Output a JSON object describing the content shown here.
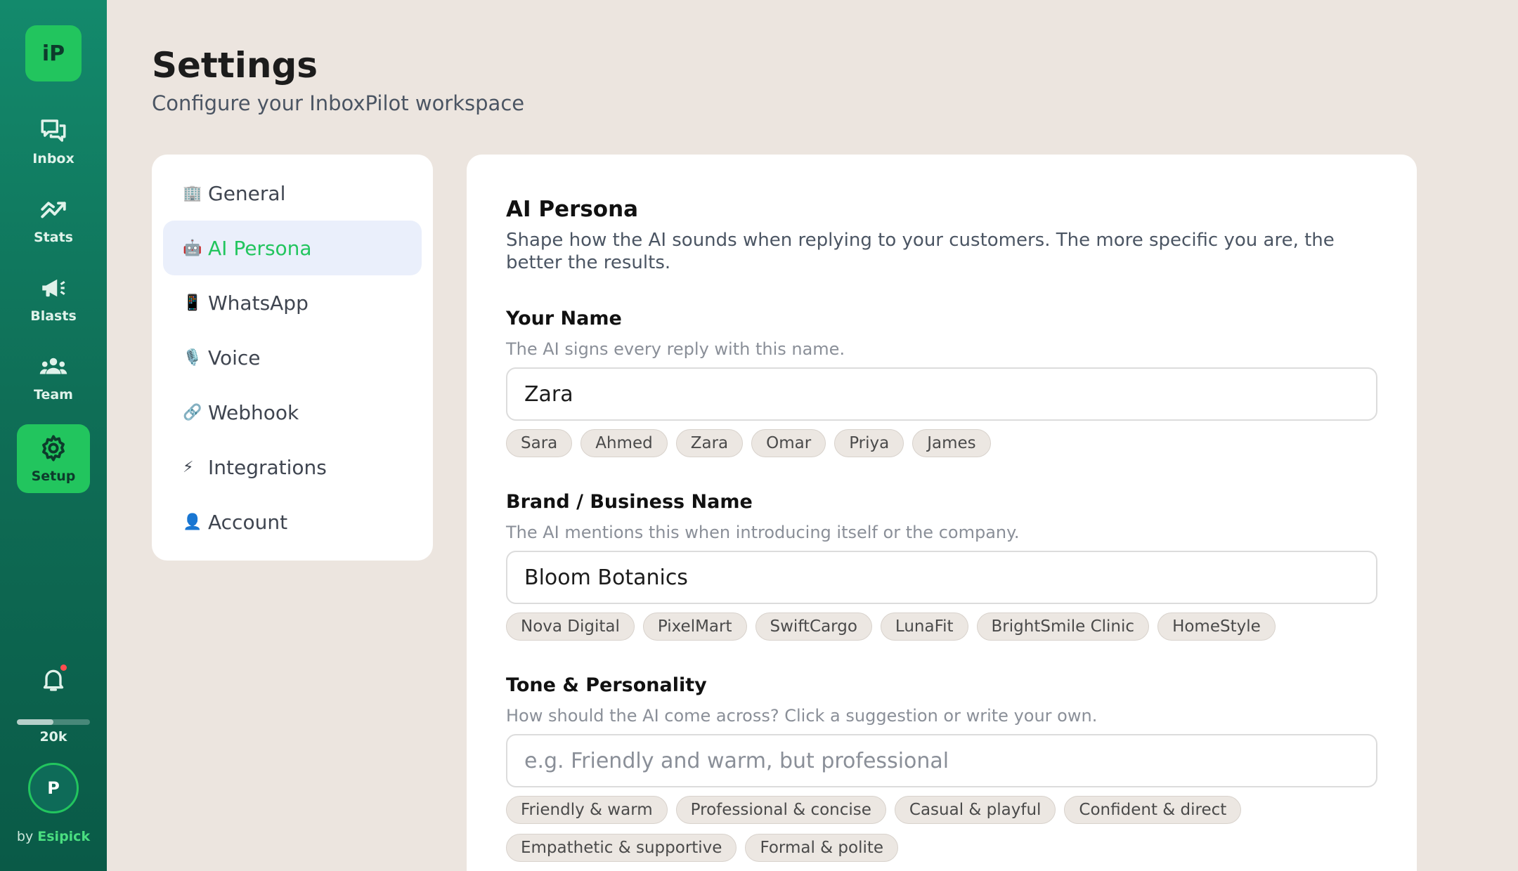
{
  "brand": {
    "logo_text": "iP"
  },
  "rail": {
    "items": [
      {
        "label": "Inbox",
        "icon": "chat-bubbles-icon"
      },
      {
        "label": "Stats",
        "icon": "trend-chart-icon"
      },
      {
        "label": "Blasts",
        "icon": "megaphone-icon"
      },
      {
        "label": "Team",
        "icon": "team-icon"
      },
      {
        "label": "Setup",
        "icon": "gear-icon",
        "active": true
      }
    ],
    "credits_label": "20k",
    "credits_fraction": 0.5,
    "avatar_initial": "P",
    "byline_prefix": "by",
    "byline_brand": "Esipick",
    "notification_dot": true
  },
  "header": {
    "title": "Settings",
    "subtitle": "Configure your InboxPilot workspace"
  },
  "nav": {
    "items": [
      {
        "label": "General",
        "icon": "🏢"
      },
      {
        "label": "AI Persona",
        "icon": "🤖",
        "active": true
      },
      {
        "label": "WhatsApp",
        "icon": "📱"
      },
      {
        "label": "Voice",
        "icon": "🎙️"
      },
      {
        "label": "Webhook",
        "icon": "🔗"
      },
      {
        "label": "Integrations",
        "icon": "⚡"
      },
      {
        "label": "Account",
        "icon": "👤"
      }
    ]
  },
  "persona": {
    "title": "AI Persona",
    "description": "Shape how the AI sounds when replying to your customers. The more specific you are, the better the results.",
    "name_field": {
      "label": "Your Name",
      "help": "The AI signs every reply with this name.",
      "value": "Zara",
      "suggestions": [
        "Sara",
        "Ahmed",
        "Zara",
        "Omar",
        "Priya",
        "James"
      ]
    },
    "brand_field": {
      "label": "Brand / Business Name",
      "help": "The AI mentions this when introducing itself or the company.",
      "value": "Bloom Botanics",
      "suggestions": [
        "Nova Digital",
        "PixelMart",
        "SwiftCargo",
        "LunaFit",
        "BrightSmile Clinic",
        "HomeStyle"
      ]
    },
    "tone_field": {
      "label": "Tone & Personality",
      "help": "How should the AI come across? Click a suggestion or write your own.",
      "value": "",
      "placeholder": "e.g. Friendly and warm, but professional",
      "suggestions": [
        "Friendly & warm",
        "Professional & concise",
        "Casual & playful",
        "Confident & direct",
        "Empathetic & supportive",
        "Formal & polite"
      ]
    }
  }
}
